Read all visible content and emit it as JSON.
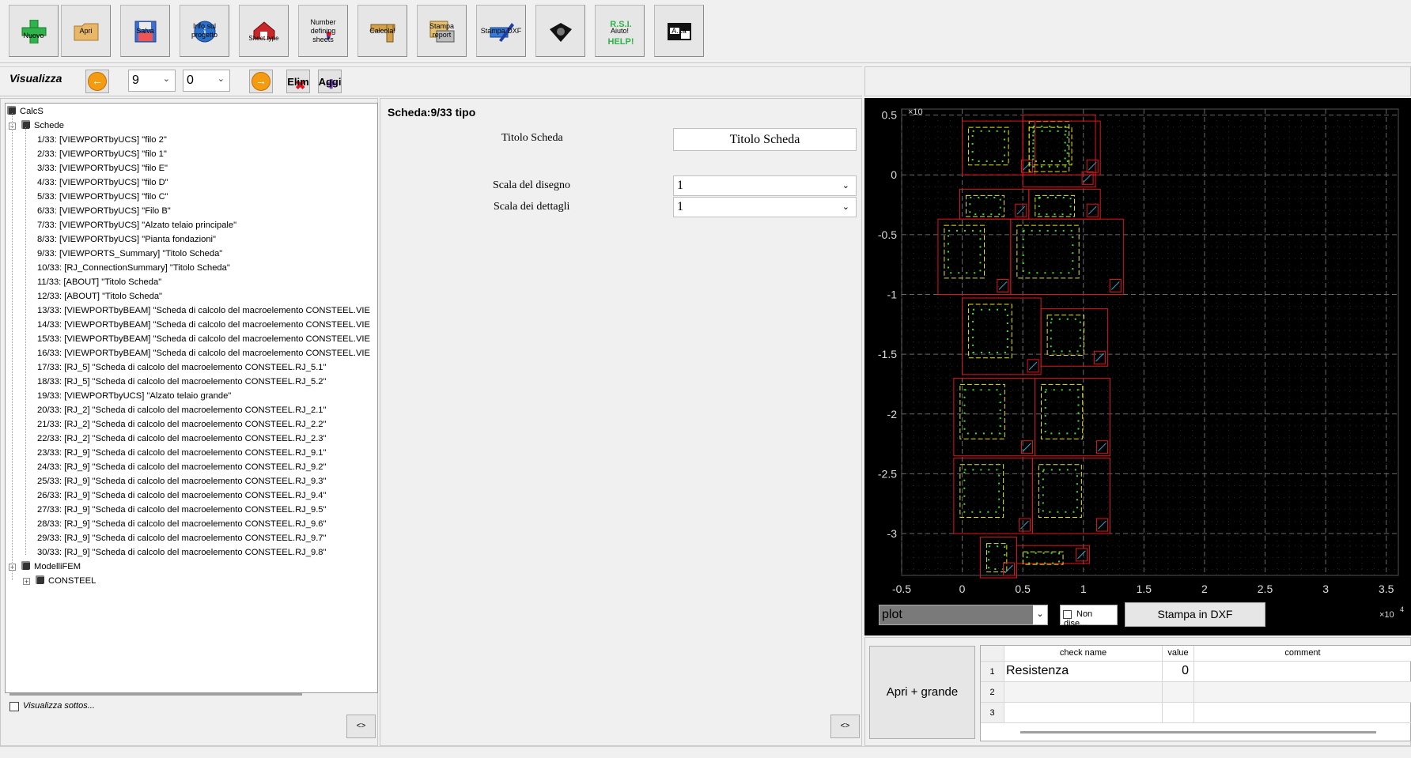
{
  "toolbar": {
    "buttons": [
      {
        "label": "Nuovo",
        "icon": "plus-icon"
      },
      {
        "label": "Apri",
        "icon": "folder-icon"
      },
      {
        "label": "Salva",
        "icon": "floppy-icon"
      },
      {
        "label": "Info sul progetto",
        "icon": "info-icon"
      },
      {
        "label": "Sheet type",
        "icon": "sheet-type-icon"
      },
      {
        "label": "Number defining sheets",
        "icon": "number-sheets-icon"
      },
      {
        "label": "Calcola!",
        "icon": "ruler-icon"
      },
      {
        "label": "Stampa report",
        "icon": "report-icon"
      },
      {
        "label": "Stampa DXF",
        "icon": "dxf-pen-icon"
      },
      {
        "label": "",
        "icon": "camera-icon"
      },
      {
        "label": "Aiuto!",
        "icon": "help-icon",
        "sublabel": "R.S.I.",
        "sublabel2": "HELP!"
      },
      {
        "label": "A...a",
        "icon": "window-icon"
      }
    ]
  },
  "nav": {
    "visualizza": "Visualizza",
    "select1": "9",
    "select2": "0",
    "elim": "Elim",
    "aggi": "Aggi"
  },
  "tree": {
    "root": "CalcS",
    "schede": "Schede",
    "items": [
      "1/33: [VIEWPORTbyUCS] \"filo 2\"",
      "2/33: [VIEWPORTbyUCS] \"filo 1\"",
      "3/33: [VIEWPORTbyUCS] \"filo E\"",
      "4/33: [VIEWPORTbyUCS] \"filo D\"",
      "5/33: [VIEWPORTbyUCS] \"filo C\"",
      "6/33: [VIEWPORTbyUCS] \"Filo B\"",
      "7/33: [VIEWPORTbyUCS] \"Alzato telaio principale\"",
      "8/33: [VIEWPORTbyUCS] \"Pianta fondazioni\"",
      "9/33: [VIEWPORTS_Summary] \"Titolo Scheda\"",
      "10/33: [RJ_ConnectionSummary] \"Titolo Scheda\"",
      "11/33: [ABOUT] \"Titolo Scheda\"",
      "12/33: [ABOUT] \"Titolo Scheda\"",
      "13/33: [VIEWPORTbyBEAM] \"Scheda di calcolo del macroelemento CONSTEEL.VIE",
      "14/33: [VIEWPORTbyBEAM] \"Scheda di calcolo del macroelemento CONSTEEL.VIE",
      "15/33: [VIEWPORTbyBEAM] \"Scheda di calcolo del macroelemento CONSTEEL.VIE",
      "16/33: [VIEWPORTbyBEAM] \"Scheda di calcolo del macroelemento CONSTEEL.VIE",
      "17/33: [RJ_5] \"Scheda di calcolo del macroelemento CONSTEEL.RJ_5.1\"",
      "18/33: [RJ_5] \"Scheda di calcolo del macroelemento CONSTEEL.RJ_5.2\"",
      "19/33: [VIEWPORTbyUCS] \"Alzato telaio grande\"",
      "20/33: [RJ_2] \"Scheda di calcolo del macroelemento CONSTEEL.RJ_2.1\"",
      "21/33: [RJ_2] \"Scheda di calcolo del macroelemento CONSTEEL.RJ_2.2\"",
      "22/33: [RJ_2] \"Scheda di calcolo del macroelemento CONSTEEL.RJ_2.3\"",
      "23/33: [RJ_9] \"Scheda di calcolo del macroelemento CONSTEEL.RJ_9.1\"",
      "24/33: [RJ_9] \"Scheda di calcolo del macroelemento CONSTEEL.RJ_9.2\"",
      "25/33: [RJ_9] \"Scheda di calcolo del macroelemento CONSTEEL.RJ_9.3\"",
      "26/33: [RJ_9] \"Scheda di calcolo del macroelemento CONSTEEL.RJ_9.4\"",
      "27/33: [RJ_9] \"Scheda di calcolo del macroelemento CONSTEEL.RJ_9.5\"",
      "28/33: [RJ_9] \"Scheda di calcolo del macroelemento CONSTEEL.RJ_9.6\"",
      "29/33: [RJ_9] \"Scheda di calcolo del macroelemento CONSTEEL.RJ_9.7\"",
      "30/33: [RJ_9] \"Scheda di calcolo del macroelemento CONSTEEL.RJ_9.8\""
    ],
    "modelli": "ModelliFEM",
    "consteel": "CONSTEEL",
    "visualizza_sottos": "Visualizza sottos...",
    "toggle_label": "<>"
  },
  "middle": {
    "heading": "Scheda:9/33 tipo",
    "titolo_label": "Titolo Scheda",
    "titolo_value": "Titolo Scheda",
    "scala_disegno_label": "Scala del disegno",
    "scala_disegno_value": "1",
    "scala_dettagli_label": "Scala dei dettagli",
    "scala_dettagli_value": "1",
    "toggle_label": "<>"
  },
  "plot": {
    "y_exponent": "×10",
    "x_exponent": "×10",
    "exp_power": "4",
    "y_ticks": [
      "0.5",
      "0",
      "-0.5",
      "-1",
      "-1.5",
      "-2",
      "-2.5",
      "-3"
    ],
    "x_ticks": [
      "-0.5",
      "0",
      "0.5",
      "1",
      "1.5",
      "2",
      "2.5",
      "3",
      "3.5"
    ],
    "combo_value": "plot",
    "non_dise": "Non dise...",
    "stampa_dxf": "Stampa in DXF"
  },
  "bottom": {
    "apri_grande": "Apri + grande",
    "table": {
      "headers": [
        "check name",
        "value",
        "comment"
      ],
      "rows": [
        {
          "num": "1",
          "name": "Resistenza",
          "value": "0",
          "comment": ""
        },
        {
          "num": "2",
          "name": "",
          "value": "",
          "comment": ""
        },
        {
          "num": "3",
          "name": "",
          "value": "",
          "comment": ""
        }
      ]
    }
  },
  "colors": {
    "plot_bg": "#000000",
    "frame_red": "#e0141e",
    "element_yellow": "#e6e61e",
    "element_green": "#3cdc3c",
    "axis_text": "#dcdcdc",
    "accent_orange": "#f39c12"
  }
}
